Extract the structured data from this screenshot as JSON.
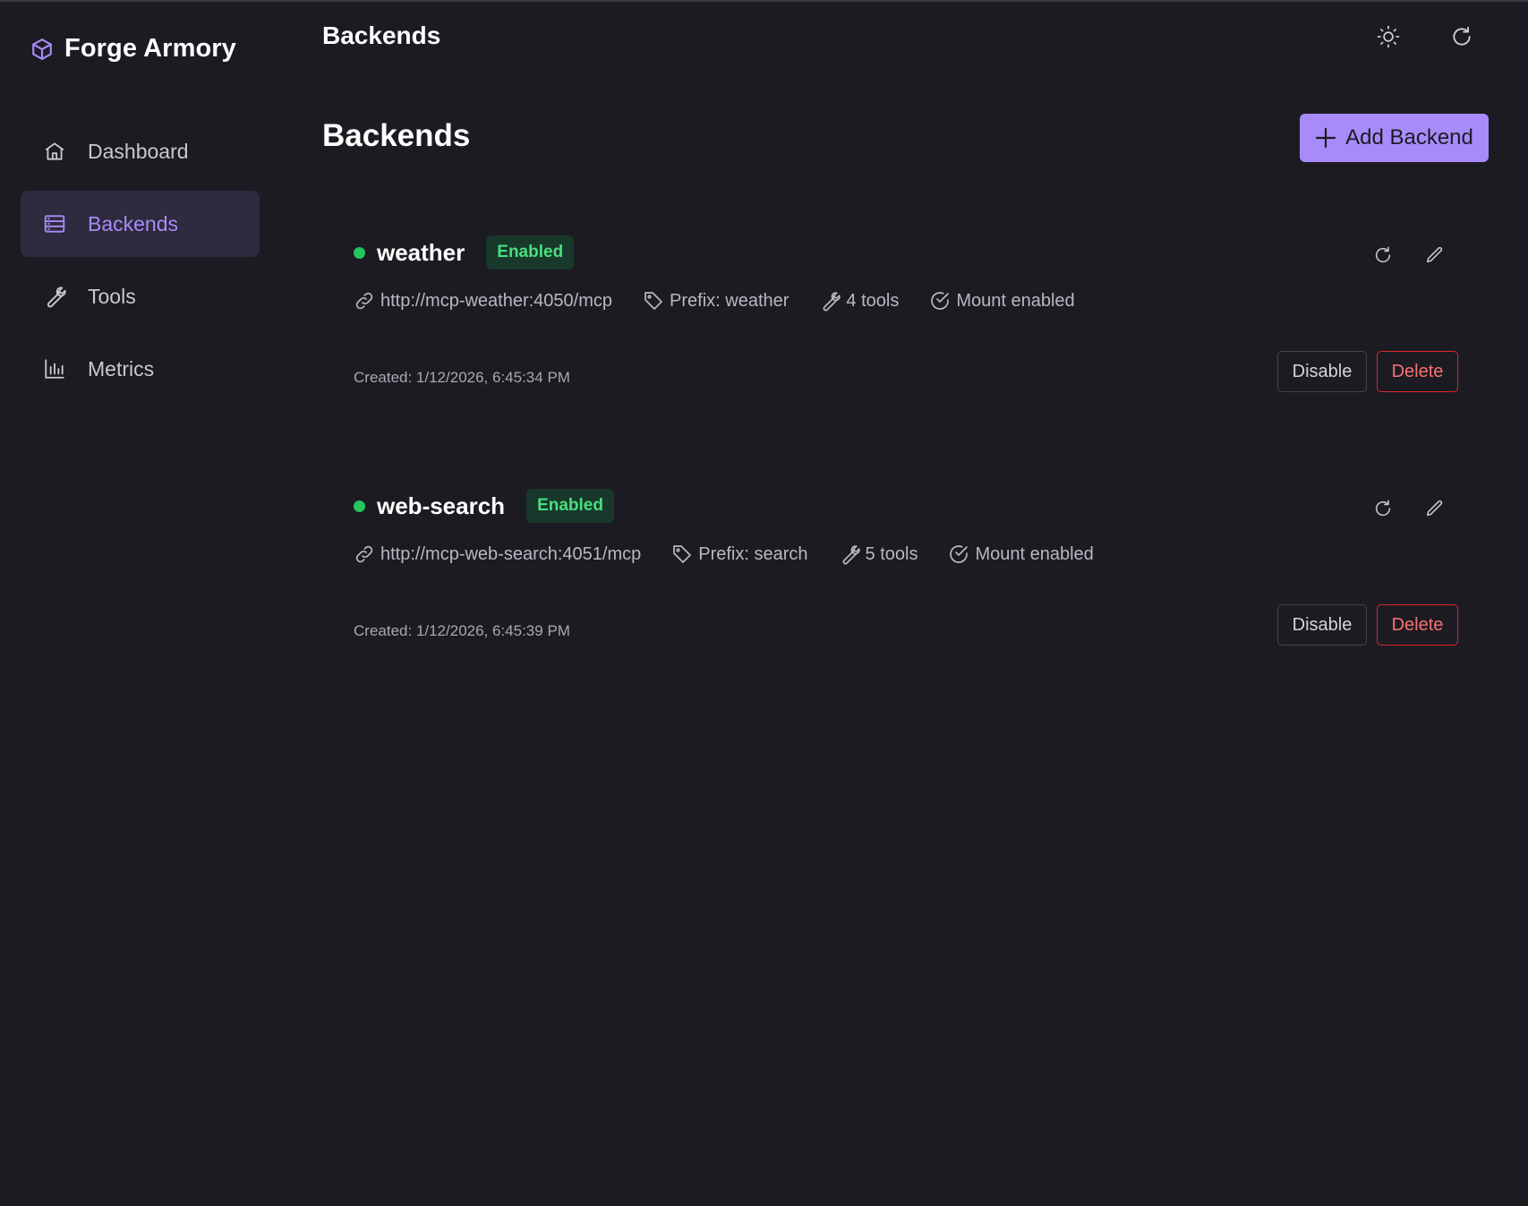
{
  "brand": {
    "name": "Forge Armory",
    "icon": "cube-icon",
    "accent": "#a78bfa"
  },
  "sidebar": {
    "items": [
      {
        "label": "Dashboard",
        "icon": "home-icon",
        "active": false
      },
      {
        "label": "Backends",
        "icon": "server-icon",
        "active": true
      },
      {
        "label": "Tools",
        "icon": "wrench-icon",
        "active": false
      },
      {
        "label": "Metrics",
        "icon": "bar-chart-icon",
        "active": false
      }
    ]
  },
  "header": {
    "title": "Backends",
    "theme_icon": "sun-icon",
    "refresh_icon": "refresh-icon"
  },
  "main": {
    "title": "Backends",
    "add_button_label": "Add Backend",
    "backends": [
      {
        "name": "weather",
        "status_badge": "Enabled",
        "url": "http://mcp-weather:4050/mcp",
        "prefix": "Prefix: weather",
        "tools": "4 tools",
        "mount": "Mount enabled",
        "created": "Created: 1/12/2026, 6:45:34 PM",
        "disable_label": "Disable",
        "delete_label": "Delete"
      },
      {
        "name": "web-search",
        "status_badge": "Enabled",
        "url": "http://mcp-web-search:4051/mcp",
        "prefix": "Prefix: search",
        "tools": "5 tools",
        "mount": "Mount enabled",
        "created": "Created: 1/12/2026, 6:45:39 PM",
        "disable_label": "Disable",
        "delete_label": "Delete"
      }
    ]
  },
  "colors": {
    "background": "#1c1b22",
    "accent": "#a78bfa",
    "success": "#22c55e",
    "danger": "#dc2626"
  }
}
